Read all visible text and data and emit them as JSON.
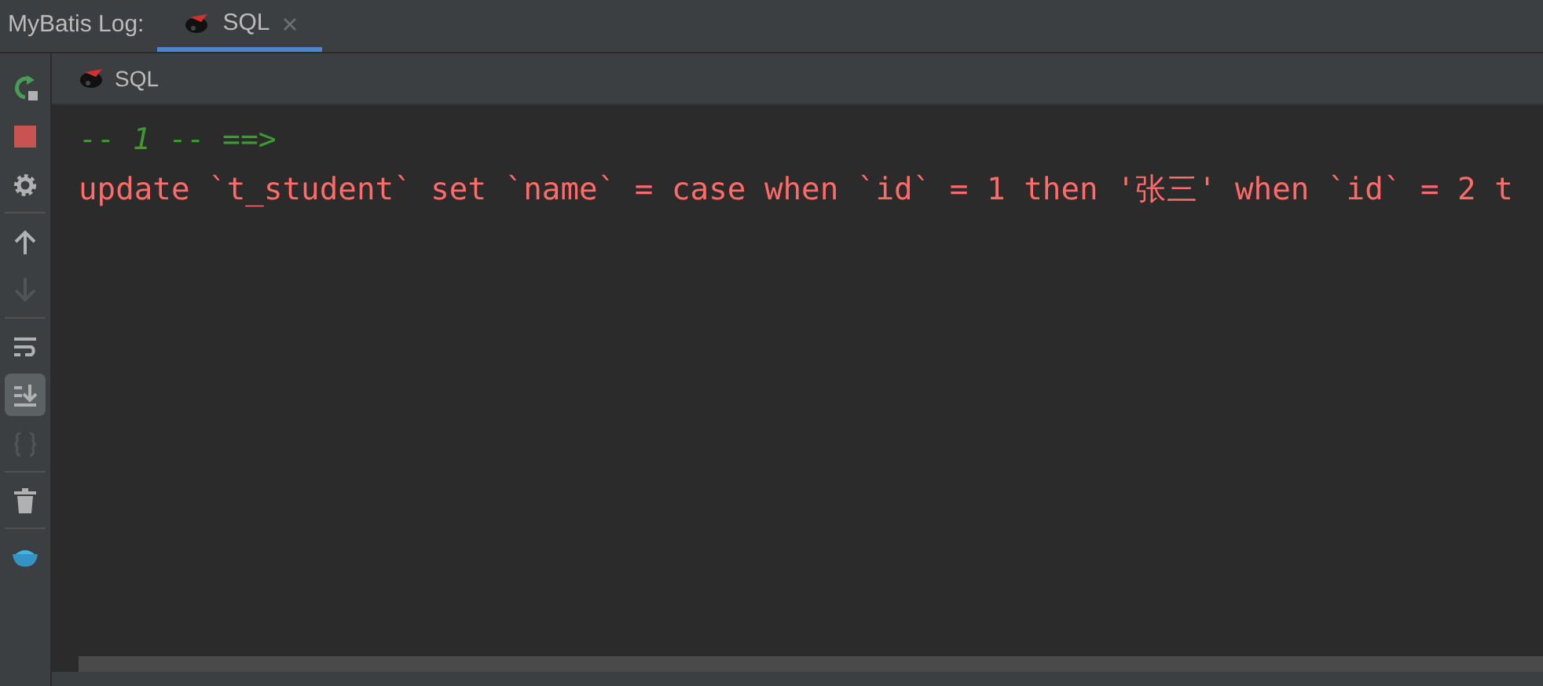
{
  "header": {
    "label": "MyBatis Log:",
    "tabs": [
      {
        "title": "SQL",
        "selected": true,
        "closable": true
      }
    ]
  },
  "toolbar": [
    {
      "kind": "rerun",
      "disabled": false,
      "selected": false
    },
    {
      "kind": "stop",
      "disabled": false,
      "selected": false
    },
    {
      "kind": "settings",
      "disabled": false,
      "selected": false
    },
    {
      "kind": "up",
      "disabled": false,
      "selected": false
    },
    {
      "kind": "down",
      "disabled": true,
      "selected": false
    },
    {
      "kind": "wrap",
      "disabled": false,
      "selected": false
    },
    {
      "kind": "scroll-end",
      "disabled": false,
      "selected": true
    },
    {
      "kind": "braces",
      "disabled": true,
      "selected": false
    },
    {
      "kind": "trash",
      "disabled": false,
      "selected": false
    },
    {
      "kind": "bird",
      "disabled": false,
      "selected": false
    }
  ],
  "console_tab": {
    "title": "SQL"
  },
  "console_lines": [
    {
      "kind": "comment",
      "text": "-- *1* -- ==>"
    },
    {
      "kind": "sql",
      "text": "update `t_student` set `name` = case when `id` = 1 then '张三' when `id` = 2 t"
    }
  ]
}
